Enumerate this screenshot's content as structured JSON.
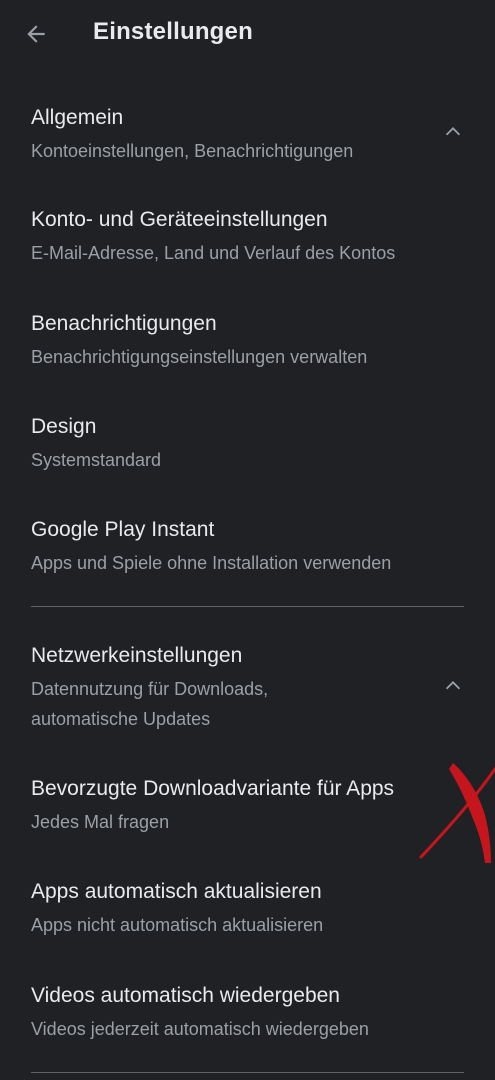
{
  "header": {
    "back_icon": "arrow-left-icon",
    "title": "Einstellungen"
  },
  "sections": {
    "general": {
      "title": "Allgemein",
      "subtitle": "Kontoeinstellungen, Benachrichtigungen",
      "state_icon": "chevron-up-icon",
      "items": [
        {
          "title": "Konto- und Geräteeinstellungen",
          "subtitle": "E-Mail-Adresse, Land und Verlauf des Kontos"
        },
        {
          "title": "Benachrichtigungen",
          "subtitle": "Benachrichtigungseinstellungen verwalten"
        },
        {
          "title": "Design",
          "subtitle": "Systemstandard"
        },
        {
          "title": "Google Play Instant",
          "subtitle": "Apps und Spiele ohne Installation verwenden"
        }
      ]
    },
    "network": {
      "title": "Netzwerkeinstellungen",
      "subtitle_line1": "Datennutzung für Downloads,",
      "subtitle_line2": "automatische Updates",
      "state_icon": "chevron-up-icon",
      "items": [
        {
          "title": "Bevorzugte Downloadvariante für Apps",
          "subtitle": "Jedes Mal fragen"
        },
        {
          "title": "Apps automatisch aktualisieren",
          "subtitle": "Apps nicht automatisch aktualisieren"
        },
        {
          "title": "Videos automatisch wiedergeben",
          "subtitle": "Videos jederzeit automatisch wiedergeben"
        }
      ]
    }
  },
  "colors": {
    "background": "#202124",
    "primary_text": "#e8eaed",
    "secondary_text": "#9aa0a6",
    "divider": "#5f6368",
    "annotation": "#c5161d"
  }
}
